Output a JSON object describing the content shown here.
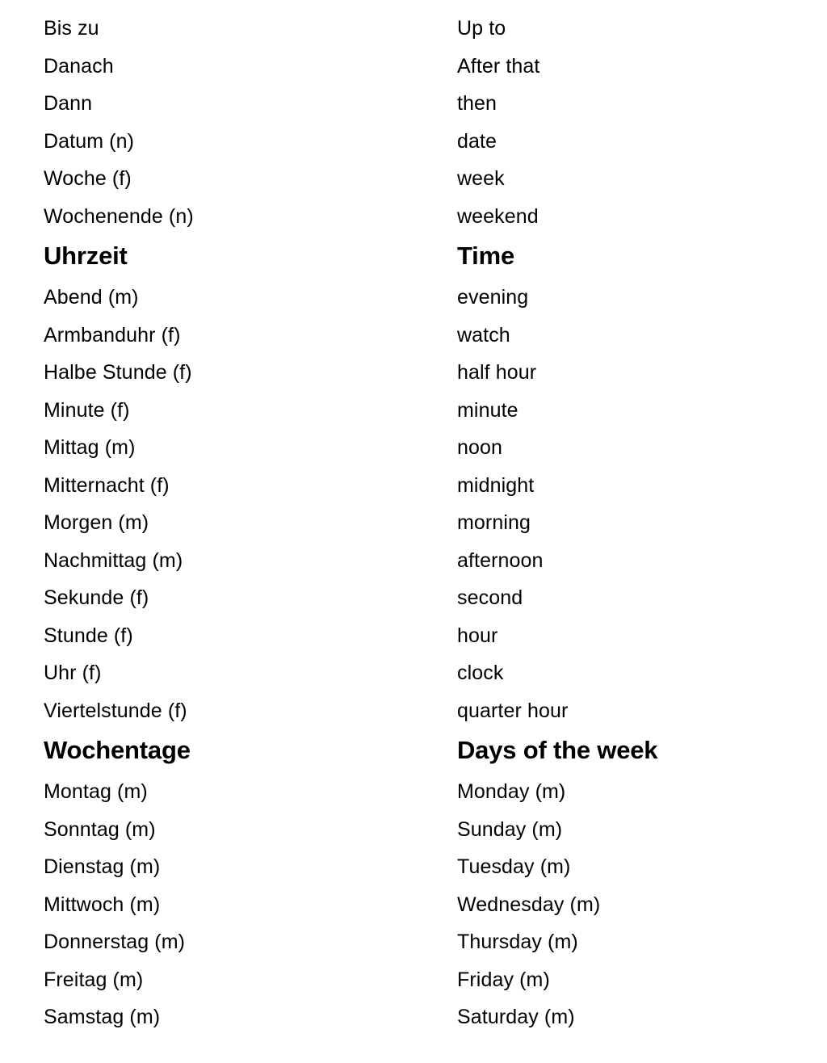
{
  "document": {
    "type": "bilingual-glossary",
    "source_language_label": "German",
    "target_language_label": "English",
    "background_color": "#ffffff",
    "text_color": "#000000"
  },
  "rows": [
    {
      "kind": "entry",
      "source": "Bis zu",
      "target": "Up to"
    },
    {
      "kind": "entry",
      "source": "Danach",
      "target": "After that"
    },
    {
      "kind": "entry",
      "source": "Dann",
      "target": "then"
    },
    {
      "kind": "entry",
      "source": "Datum (n)",
      "target": "date"
    },
    {
      "kind": "entry",
      "source": "Woche (f)",
      "target": "week"
    },
    {
      "kind": "entry",
      "source": "Wochenende (n)",
      "target": "weekend"
    },
    {
      "kind": "heading",
      "source": "Uhrzeit",
      "target": "Time"
    },
    {
      "kind": "entry",
      "source": "Abend (m)",
      "target": "evening"
    },
    {
      "kind": "entry",
      "source": "Armbanduhr (f)",
      "target": "watch"
    },
    {
      "kind": "entry",
      "source": "Halbe Stunde (f)",
      "target": "half hour"
    },
    {
      "kind": "entry",
      "source": "Minute (f)",
      "target": "minute"
    },
    {
      "kind": "entry",
      "source": "Mittag (m)",
      "target": "noon"
    },
    {
      "kind": "entry",
      "source": "Mitternacht (f)",
      "target": "midnight"
    },
    {
      "kind": "entry",
      "source": "Morgen (m)",
      "target": "morning"
    },
    {
      "kind": "entry",
      "source": "Nachmittag (m)",
      "target": "afternoon"
    },
    {
      "kind": "entry",
      "source": "Sekunde (f)",
      "target": "second"
    },
    {
      "kind": "entry",
      "source": "Stunde (f)",
      "target": "hour"
    },
    {
      "kind": "entry",
      "source": "Uhr (f)",
      "target": "clock"
    },
    {
      "kind": "entry",
      "source": "Viertelstunde (f)",
      "target": "quarter hour"
    },
    {
      "kind": "heading",
      "source": "Wochentage",
      "target": "Days of the week"
    },
    {
      "kind": "entry",
      "source": "Montag (m)",
      "target": "Monday (m)"
    },
    {
      "kind": "entry",
      "source": "Sonntag (m)",
      "target": "Sunday (m)"
    },
    {
      "kind": "entry",
      "source": "Dienstag (m)",
      "target": "Tuesday (m)"
    },
    {
      "kind": "entry",
      "source": "Mittwoch (m)",
      "target": "Wednesday (m)"
    },
    {
      "kind": "entry",
      "source": "Donnerstag (m)",
      "target": "Thursday (m)"
    },
    {
      "kind": "entry",
      "source": "Freitag (m)",
      "target": "Friday (m)"
    },
    {
      "kind": "entry",
      "source": "Samstag (m)",
      "target": "Saturday (m)"
    }
  ]
}
